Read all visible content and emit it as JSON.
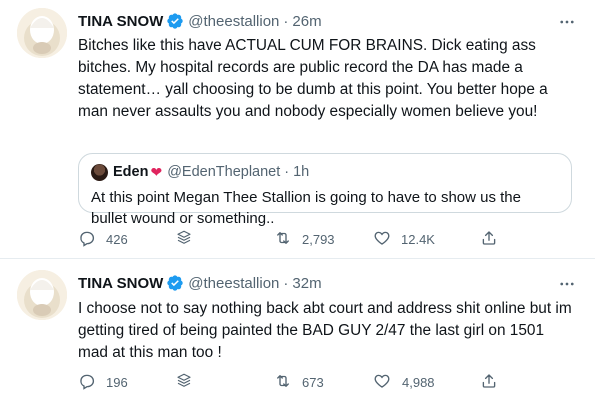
{
  "tweets": [
    {
      "author_name": "TINA SNOW",
      "handle": "@theestallion",
      "separator": "·",
      "time": "26m",
      "text": "Bitches like this have ACTUAL CUM FOR BRAINS. Dick eating ass bitches. My hospital records are public record the DA has made a statement… yall choosing to be dumb at this point. You better hope a man never assaults you and nobody especially women believe you!",
      "quote": {
        "author_name": "Eden",
        "heart": "❤",
        "handle": "@EdenTheplanet",
        "separator": "·",
        "time": "1h",
        "text": "At this point Megan Thee Stallion is going to have to show us the bullet wound or something.."
      },
      "replies": "426",
      "retweets": "2,793",
      "likes": "12.4K"
    },
    {
      "author_name": "TINA SNOW",
      "handle": "@theestallion",
      "separator": "·",
      "time": "32m",
      "text": "I choose not to say nothing back abt court and address shit online but im getting tired of being painted the BAD GUY 2/47 the last girl on 1501 mad at this man too !",
      "replies": "196",
      "retweets": "673",
      "likes": "4,988"
    }
  ],
  "colors": {
    "verified": "#1d9bf0",
    "secondary_text": "#536471",
    "icon": "#536471",
    "divider": "#e6ecf0",
    "heart": "#e0245e"
  },
  "icons": [
    "avatar",
    "verified-badge-icon",
    "more-icon",
    "reply-icon",
    "stack-icon",
    "retweet-icon",
    "like-icon",
    "share-icon"
  ]
}
